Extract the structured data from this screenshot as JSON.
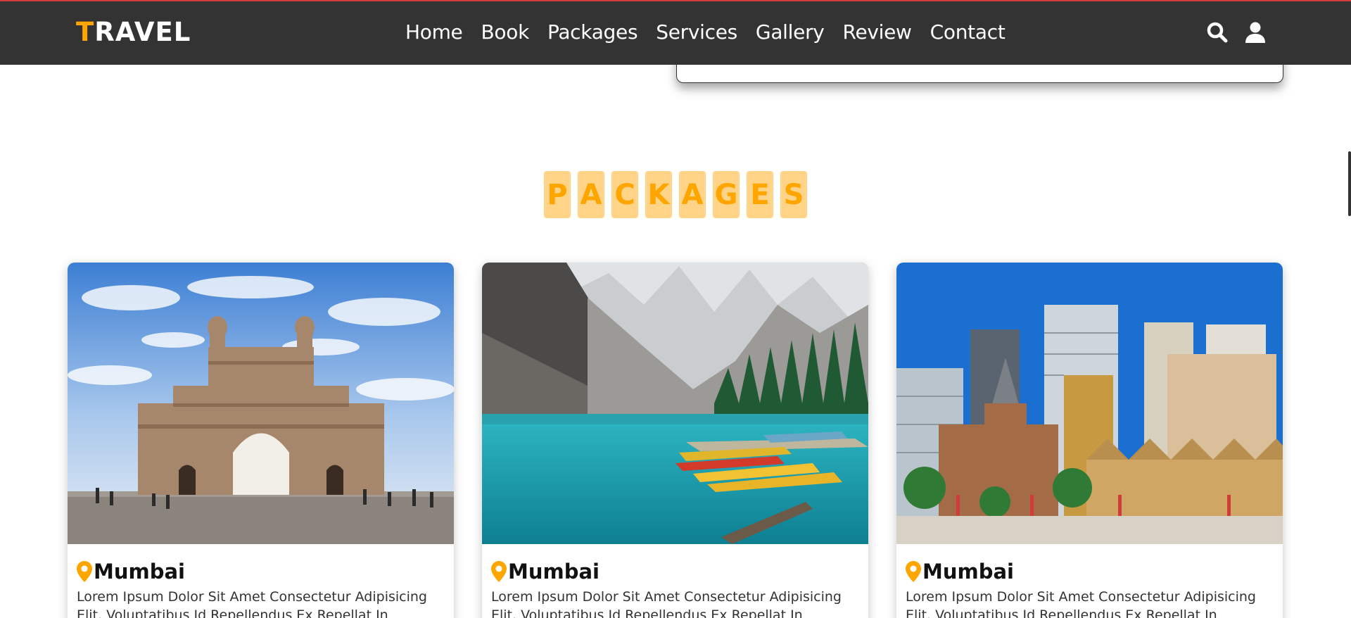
{
  "header": {
    "logo_first": "T",
    "logo_rest": "RAVEL",
    "nav": [
      "Home",
      "Book",
      "Packages",
      "Services",
      "Gallery",
      "Review",
      "Contact"
    ],
    "icons": [
      "search-icon",
      "user-icon"
    ],
    "colors": {
      "bar": "#333333",
      "accent": "#ffa500",
      "top_border": "#d23b3b"
    }
  },
  "section": {
    "heading_letters": [
      "P",
      "A",
      "C",
      "K",
      "A",
      "G",
      "E",
      "S"
    ]
  },
  "packages": [
    {
      "title": "Mumbai",
      "text": "Lorem Ipsum Dolor Sit Amet Consectetur Adipisicing Elit. Voluptatibus Id Repellendus Ex Repellat In Laborum Harum"
    },
    {
      "title": "Mumbai",
      "text": "Lorem Ipsum Dolor Sit Amet Consectetur Adipisicing Elit. Voluptatibus Id Repellendus Ex Repellat In Laborum Harum"
    },
    {
      "title": "Mumbai",
      "text": "Lorem Ipsum Dolor Sit Amet Consectetur Adipisicing Elit. Voluptatibus Id Repellendus Ex Repellat In Laborum Harum"
    }
  ]
}
